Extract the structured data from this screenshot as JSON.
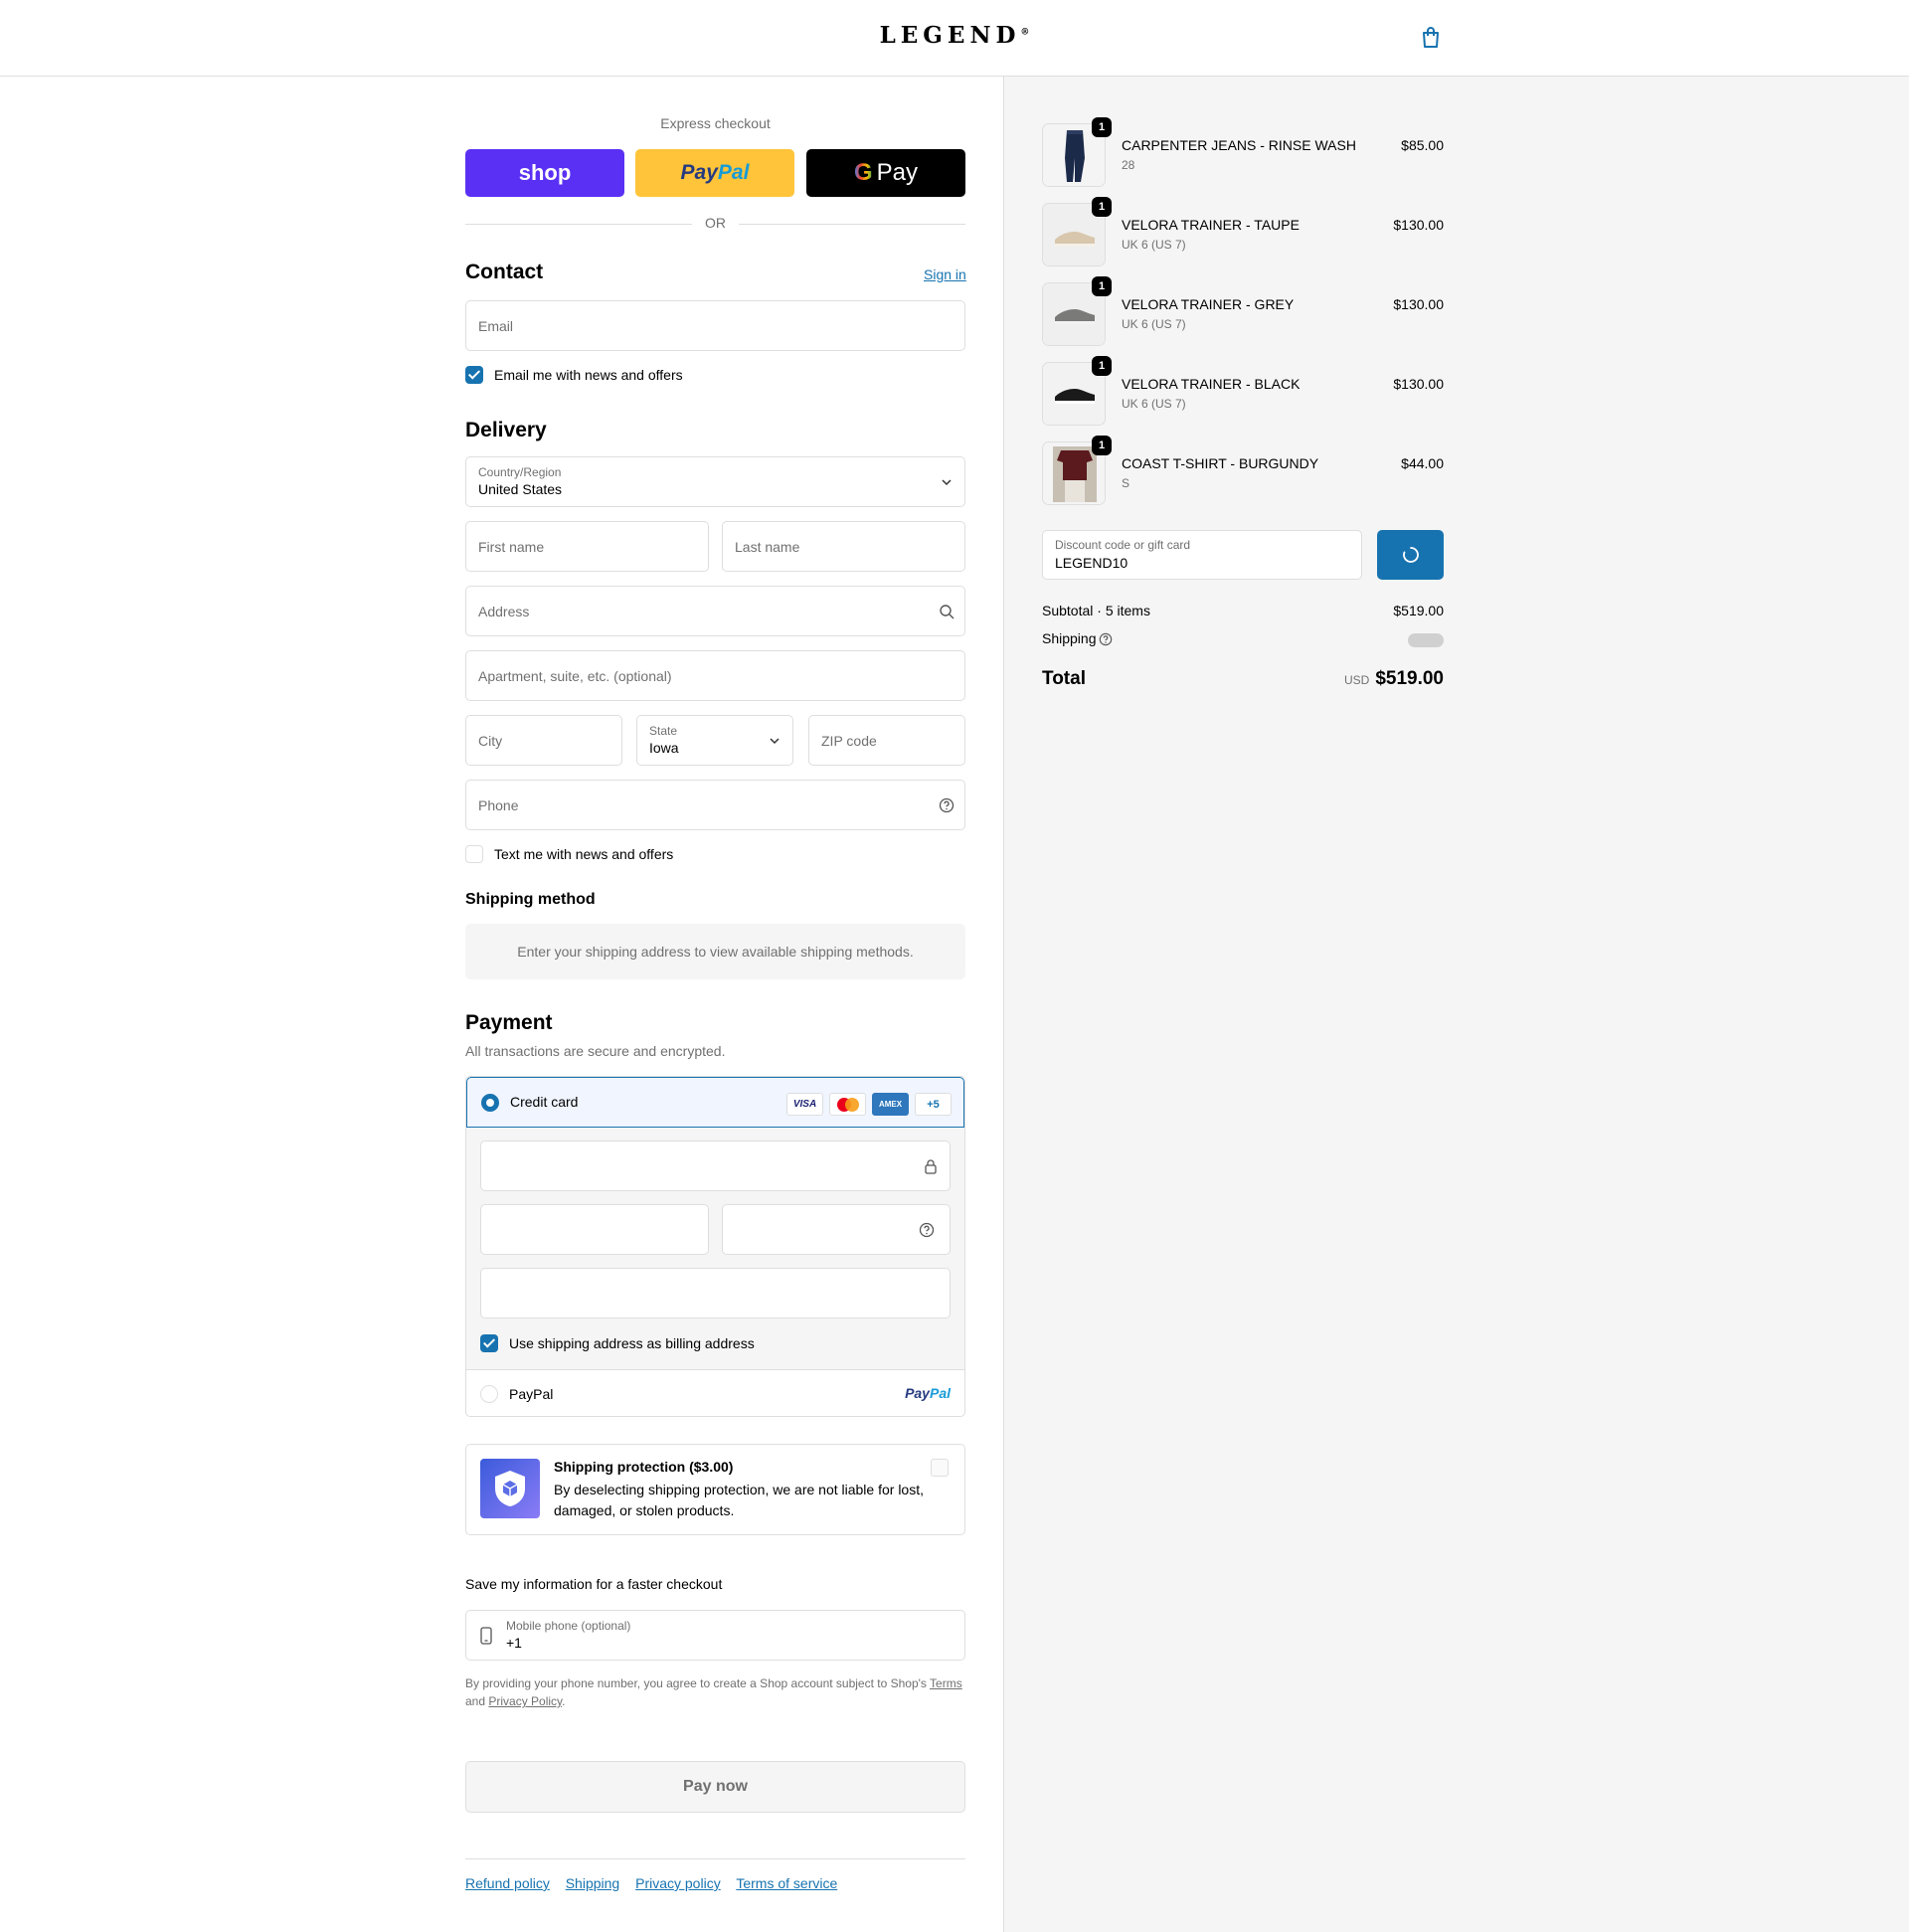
{
  "header": {
    "brand": "LEGEND",
    "brand_mark": "®",
    "cart_icon": "shopping-bag-icon"
  },
  "express": {
    "label": "Express checkout",
    "shop_label": "shop",
    "paypal_part1": "Pay",
    "paypal_part2": "Pal",
    "gpay_g": "G",
    "gpay_label": "Pay",
    "or": "OR"
  },
  "contact": {
    "title": "Contact",
    "sign_in": "Sign in",
    "email_placeholder": "Email",
    "email_news_label": "Email me with news and offers",
    "email_news_checked": true
  },
  "delivery": {
    "title": "Delivery",
    "country_label": "Country/Region",
    "country_value": "United States",
    "first_name_placeholder": "First name",
    "last_name_placeholder": "Last name",
    "address_placeholder": "Address",
    "apartment_placeholder": "Apartment, suite, etc. (optional)",
    "city_placeholder": "City",
    "state_label": "State",
    "state_value": "Iowa",
    "zip_placeholder": "ZIP code",
    "phone_placeholder": "Phone",
    "text_news_label": "Text me with news and offers",
    "text_news_checked": false
  },
  "shipping_method": {
    "title": "Shipping method",
    "message": "Enter your shipping address to view available shipping methods."
  },
  "payment": {
    "title": "Payment",
    "subtitle": "All transactions are secure and encrypted.",
    "credit_card_label": "Credit card",
    "cards": [
      "VISA",
      "MC",
      "AMEX",
      "+5"
    ],
    "billing_label": "Use shipping address as billing address",
    "billing_checked": true,
    "paypal_label": "PayPal",
    "paypal_logo_part1": "Pay",
    "paypal_logo_part2": "Pal"
  },
  "protection": {
    "title": "Shipping protection ($3.00)",
    "description": "By deselecting shipping protection, we are not liable for lost, damaged, or stolen products."
  },
  "save_info": {
    "title": "Save my information for a faster checkout",
    "phone_label": "Mobile phone (optional)",
    "phone_value": "+1",
    "legal_prefix": "By providing your phone number, you agree to create a Shop account subject to Shop's",
    "terms": "Terms",
    "and": "and",
    "privacy": "Privacy Policy"
  },
  "pay_now": "Pay now",
  "footer_links": [
    "Refund policy",
    "Shipping",
    "Privacy policy",
    "Terms of service"
  ],
  "order": {
    "items": [
      {
        "name": "CARPENTER JEANS - RINSE WASH",
        "variant": "28",
        "price": "$85.00",
        "qty": "1"
      },
      {
        "name": "VELORA TRAINER - TAUPE",
        "variant": "UK 6 (US 7)",
        "price": "$130.00",
        "qty": "1"
      },
      {
        "name": "VELORA TRAINER - GREY",
        "variant": "UK 6 (US 7)",
        "price": "$130.00",
        "qty": "1"
      },
      {
        "name": "VELORA TRAINER - BLACK",
        "variant": "UK 6 (US 7)",
        "price": "$130.00",
        "qty": "1"
      },
      {
        "name": "COAST T-SHIRT - BURGUNDY",
        "variant": "S",
        "price": "$44.00",
        "qty": "1"
      }
    ],
    "discount_label": "Discount code or gift card",
    "discount_value": "LEGEND10",
    "subtotal_label": "Subtotal · 5 items",
    "subtotal_value": "$519.00",
    "shipping_label": "Shipping",
    "total_label": "Total",
    "total_currency": "USD",
    "total_value": "$519.00"
  }
}
